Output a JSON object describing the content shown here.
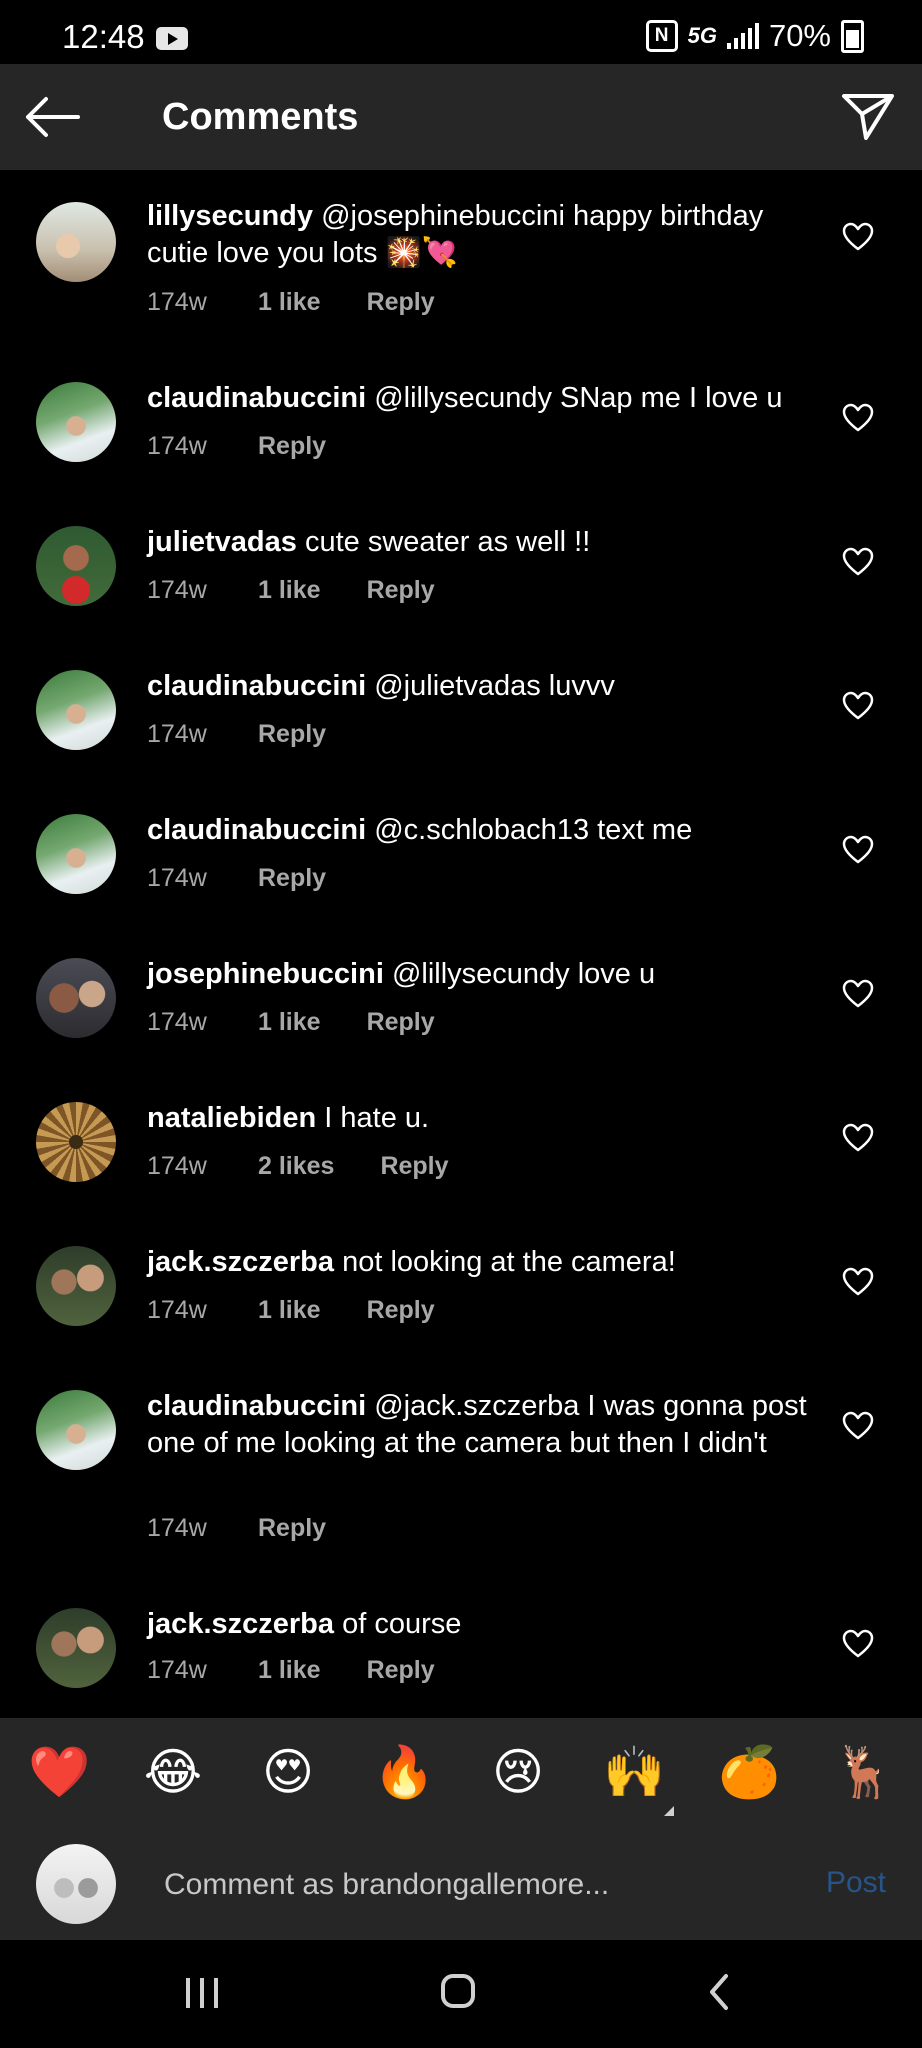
{
  "status_bar": {
    "time": "12:48",
    "network": "5G",
    "battery": "70%"
  },
  "header": {
    "title": "Comments"
  },
  "comments": [
    {
      "username": "lillysecundy",
      "text": "@josephinebuccini happy birthday cutie love you lots 🎇💘",
      "time": "174w",
      "likes": "1 like",
      "reply": "Reply"
    },
    {
      "username": "claudinabuccini",
      "text": "@lillysecundy SNap me I love u",
      "time": "174w",
      "likes": "",
      "reply": "Reply"
    },
    {
      "username": "julietvadas",
      "text": "cute sweater as well !!",
      "time": "174w",
      "likes": "1 like",
      "reply": "Reply"
    },
    {
      "username": "claudinabuccini",
      "text": "@julietvadas luvvv",
      "time": "174w",
      "likes": "",
      "reply": "Reply"
    },
    {
      "username": "claudinabuccini",
      "text": "@c.schlobach13 text me",
      "time": "174w",
      "likes": "",
      "reply": "Reply"
    },
    {
      "username": "josephinebuccini",
      "text": "@lillysecundy love u",
      "time": "174w",
      "likes": "1 like",
      "reply": "Reply"
    },
    {
      "username": "nataliebiden",
      "text": "I hate u.",
      "time": "174w",
      "likes": "2 likes",
      "reply": "Reply"
    },
    {
      "username": "jack.szczerba",
      "text": "not looking at the camera!",
      "time": "174w",
      "likes": "1 like",
      "reply": "Reply"
    },
    {
      "username": "claudinabuccini",
      "text": "@jack.szczerba I was gonna post one of me looking at the camera but then I didn't",
      "time": "174w",
      "likes": "",
      "reply": "Reply"
    },
    {
      "username": "jack.szczerba",
      "text": "of course",
      "time": "174w",
      "likes": "1 like",
      "reply": "Reply"
    }
  ],
  "emoji_bar": [
    "❤️",
    "😂",
    "😍",
    "🔥",
    "😢",
    "🙌",
    "🍊",
    "🦌"
  ],
  "comment_input": {
    "placeholder": "Comment as brandongallemore...",
    "post_label": "Post"
  },
  "colors": {
    "background": "#000000",
    "header": "#262626",
    "meta_text": "#a8a8a8",
    "post_button_disabled": "#27558a"
  }
}
